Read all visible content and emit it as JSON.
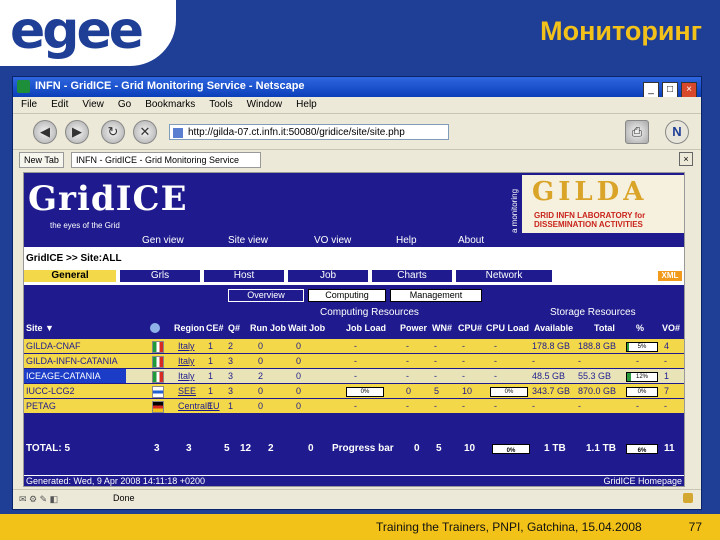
{
  "slide": {
    "logo": "egee",
    "title": "Мониторинг",
    "footer": "Training the Trainers, PNPI, Gatchina, 15.04.2008",
    "page": "77"
  },
  "window": {
    "title": "INFN - GridICE - Grid Monitoring Service - Netscape",
    "buttons": [
      "_",
      "□",
      "×"
    ]
  },
  "menu": [
    "File",
    "Edit",
    "View",
    "Go",
    "Bookmarks",
    "Tools",
    "Window",
    "Help"
  ],
  "address": "http://gilda-07.ct.infn.it:50080/gridice/site/site.php",
  "tabs": [
    "New Tab",
    "INFN - GridICE - Grid Monitoring Service"
  ],
  "banner": {
    "logo": "GridICE",
    "tagline": "the eyes of the Grid",
    "vertical": "a monitoring",
    "partner_logo": "GILDA",
    "partner_sub1": "GRID INFN LABORATORY for",
    "partner_sub2": "DISSEMINATION ACTIVITIES"
  },
  "topnav": [
    "Gen view",
    "Site view",
    "VO view",
    "Help",
    "About"
  ],
  "breadcrumb": "GridICE >> Site:ALL",
  "section_tabs": [
    "General",
    "Grls",
    "Host",
    "Job",
    "Charts",
    "Network"
  ],
  "xml_label": "XML",
  "subtabs": [
    "Overview",
    "Computing",
    "Management"
  ],
  "groups": {
    "computing": "Computing Resources",
    "storage": "Storage Resources"
  },
  "columns": [
    "Site ▼",
    "Region",
    "CE#",
    "Q#",
    "Run Job",
    "Wait Job",
    "Job Load",
    "Power",
    "WN#",
    "CPU#",
    "CPU Load",
    "Available",
    "Total",
    "%",
    "VO#"
  ],
  "rows": [
    {
      "site": "GILDA-CNAF",
      "region": "Italy",
      "ce": "1",
      "q": "2",
      "run": "0",
      "wait": "0",
      "jobload": "-",
      "power": "-",
      "wn": "-",
      "cpu": "-",
      "cpuload": "-",
      "avail": "178.8 GB",
      "total": "188.8 GB",
      "pct": "5%",
      "vo": "4",
      "flag": "italy"
    },
    {
      "site": "GILDA-INFN-CATANIA",
      "region": "Italy",
      "ce": "1",
      "q": "3",
      "run": "0",
      "wait": "0",
      "jobload": "-",
      "power": "-",
      "wn": "-",
      "cpu": "-",
      "cpuload": "-",
      "avail": "-",
      "total": "-",
      "pct": "",
      "vo": "-",
      "flag": "italy"
    },
    {
      "site": "ICEAGE-CATANIA",
      "region": "Italy",
      "ce": "1",
      "q": "3",
      "run": "2",
      "wait": "0",
      "jobload": "-",
      "power": "-",
      "wn": "-",
      "cpu": "-",
      "cpuload": "-",
      "avail": "48.5 GB",
      "total": "55.3 GB",
      "pct": "12%",
      "vo": "1",
      "flag": "italy",
      "selected": true
    },
    {
      "site": "IUCC-LCG2",
      "region": "SEE",
      "ce": "1",
      "q": "3",
      "run": "0",
      "wait": "0",
      "jobload": "0%",
      "power": "0",
      "wn": "5",
      "cpu": "10",
      "cpuload": "0%",
      "avail": "343.7 GB",
      "total": "870.0 GB",
      "pct": "0%",
      "vo": "7",
      "flag": "israel"
    },
    {
      "site": "PETAG",
      "region": "CentralEU",
      "ce": "1",
      "q": "1",
      "run": "0",
      "wait": "0",
      "jobload": "-",
      "power": "-",
      "wn": "-",
      "cpu": "-",
      "cpuload": "-",
      "avail": "-",
      "total": "-",
      "pct": "",
      "vo": "-",
      "flag": "germany"
    }
  ],
  "progress": {
    "jobload_iucc": 0,
    "cpuload_iucc": 0,
    "storage": [
      0.05,
      0,
      0.12,
      0.0,
      0
    ]
  },
  "totals": {
    "label": "TOTAL: 5",
    "sites": "3",
    "regions": "3",
    "ce": "5",
    "q": "12",
    "run": "2",
    "wait": "0",
    "jobload": "Progress bar",
    "power": "0",
    "wn": "5",
    "cpu": "10",
    "cpuload": "0%",
    "avail": "1 TB",
    "total": "1.1 TB",
    "pct": "6%",
    "vo": "11"
  },
  "generated": "Generated: Wed, 9 Apr 2008 14:11:18 +0200",
  "homepage": "GridICE Homepage",
  "status": "Done"
}
